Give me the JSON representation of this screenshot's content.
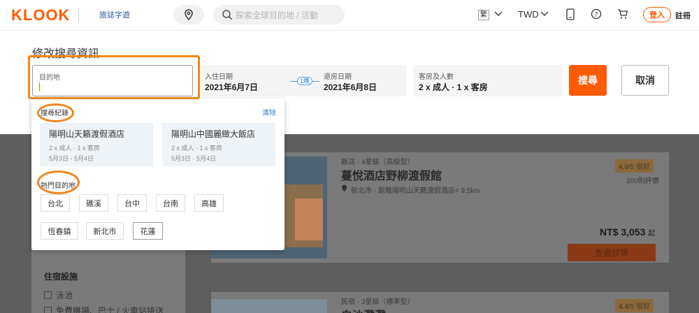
{
  "header": {
    "logo": "KLOOK",
    "partner_logo": "旅誌字遊",
    "search_placeholder": "探索全球目的地 / 活動",
    "language": "繁",
    "currency": "TWD",
    "login": "登入",
    "signup": "註冊"
  },
  "modify_search": {
    "title": "修改搜尋資訊",
    "destination_label": "目的地",
    "destination_value": "",
    "checkin_label": "入住日期",
    "checkin_value": "2021年6月7日",
    "nights": "1晚",
    "checkout_label": "退房日期",
    "checkout_value": "2021年6月8日",
    "guests_label": "客房及人數",
    "guests_value": "2 x 成人 · 1 x 客房",
    "search_button": "搜尋",
    "cancel_button": "取消"
  },
  "dropdown": {
    "history_title": "搜尋紀錄",
    "clear": "清除",
    "history": [
      {
        "name": "陽明山天籟渡假酒店",
        "guests": "2 x 成人 · 1 x 客房",
        "dates": "5月3日 - 5月4日"
      },
      {
        "name": "陽明山中國麗緻大飯店",
        "guests": "2 x 成人 · 1 x 客房",
        "dates": "5月3日 - 5月4日"
      }
    ],
    "popular_title": "熱門目的地",
    "popular": [
      "台北",
      "礁溪",
      "台中",
      "台南",
      "高雄",
      "恆春鎮",
      "新北市",
      "花蓮"
    ]
  },
  "results": [
    {
      "type": "飯店 · 4星級（高級型）",
      "name": "蔓悅酒店野柳渡假館",
      "location": "新北市 - 距離陽明山天籟渡假酒店< 9.5km",
      "rating": "4.0",
      "rating_suffix": "/5 很好",
      "reviews": "100則評價",
      "price": "NT$ 3,053",
      "price_suffix": "起",
      "detail_button": "查看詳情"
    },
    {
      "type": "民宿 · 3星級（標準型）",
      "name": "白沙灘灘",
      "rating": "4.4",
      "rating_suffix": "/5 很好"
    }
  ],
  "filters": {
    "title": "住宿設施",
    "items": [
      "泳池",
      "免費機場、巴士 / 火車站接送"
    ]
  },
  "colors": {
    "brand": "#ff5b00",
    "annotation": "#f0861d",
    "link": "#2f7fc1"
  }
}
